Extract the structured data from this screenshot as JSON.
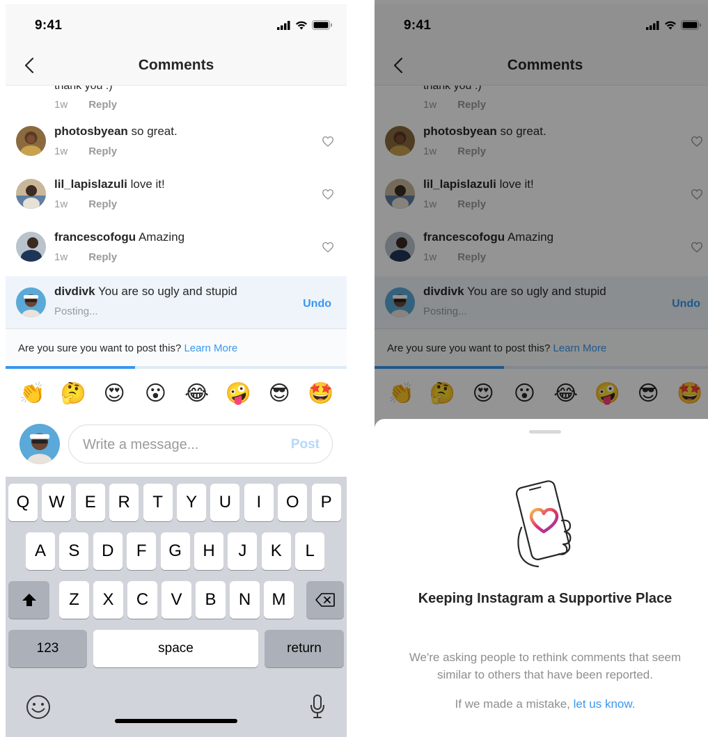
{
  "status": {
    "time": "9:41"
  },
  "nav": {
    "title": "Comments"
  },
  "clipped_comment": {
    "text": "thank you :)",
    "age": "1w",
    "reply": "Reply"
  },
  "comments": [
    {
      "user": "photosbyean",
      "text": "so great.",
      "age": "1w",
      "reply": "Reply"
    },
    {
      "user": "lil_lapislazuli",
      "text": "love it!",
      "age": "1w",
      "reply": "Reply"
    },
    {
      "user": "francescofogu",
      "text": "Amazing",
      "age": "1w",
      "reply": "Reply"
    }
  ],
  "pending_comment": {
    "user": "divdivk",
    "text": "You are so ugly and stupid",
    "status": "Posting...",
    "undo": "Undo"
  },
  "warning": {
    "text": "Are you sure you want to post this?",
    "link": "Learn More",
    "progress": 0.38
  },
  "emojis": [
    "👏",
    "🤔",
    "😍",
    "😮",
    "😂",
    "🤪",
    "😎",
    "🤩"
  ],
  "composer": {
    "placeholder": "Write a message...",
    "post": "Post"
  },
  "keyboard": {
    "row1": [
      "Q",
      "W",
      "E",
      "R",
      "T",
      "Y",
      "U",
      "I",
      "O",
      "P"
    ],
    "row2": [
      "A",
      "S",
      "D",
      "F",
      "G",
      "H",
      "J",
      "K",
      "L"
    ],
    "row3": [
      "Z",
      "X",
      "C",
      "V",
      "B",
      "N",
      "M"
    ],
    "numbers": "123",
    "space": "space",
    "return": "return"
  },
  "sheet": {
    "title": "Keeping Instagram a Supportive Place",
    "body": "We're asking people to rethink comments that seem similar to others that have been reported.",
    "footer_prefix": "If we made a mistake,",
    "footer_link": "let us know."
  },
  "colors": {
    "link": "#3897f0",
    "pending_bg": "#eef4fa",
    "overlay": "rgba(0,0,0,0.42)"
  }
}
